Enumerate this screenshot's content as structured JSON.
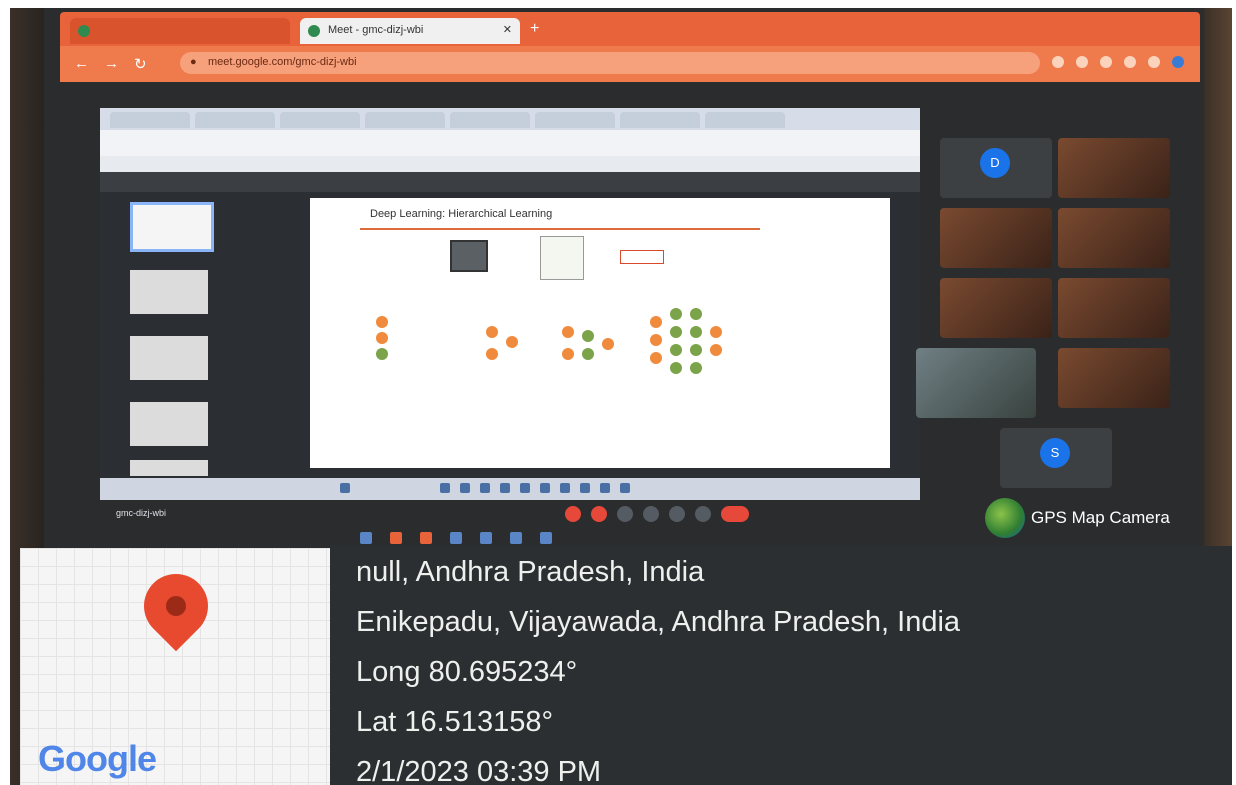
{
  "gps_overlay": {
    "badge": "GPS Map Camera",
    "map_brand": "Google",
    "place": "null, Andhra Pradesh, India",
    "address": "Enikepadu, Vijayawada, Andhra Pradesh, India",
    "longitude": "Long 80.695234°",
    "latitude": "Lat 16.513158°",
    "datetime": "2/1/2023 03:39 PM"
  },
  "browser": {
    "tab_title": "Meet - gmc-dizj-wbi",
    "url": "meet.google.com/gmc-dizj-wbi"
  },
  "meet": {
    "meeting_code": "gmc-dizj-wbi"
  },
  "slide": {
    "title": "Deep Learning: Hierarchical Learning"
  },
  "participants": [
    {
      "initial": "D",
      "color": "#1a73e8"
    },
    {
      "initial": "S",
      "color": "#1a73e8"
    }
  ],
  "colors": {
    "tabbar": "#e8623a",
    "slide_accent": "#e06b3a",
    "pin": "#e84a30"
  }
}
